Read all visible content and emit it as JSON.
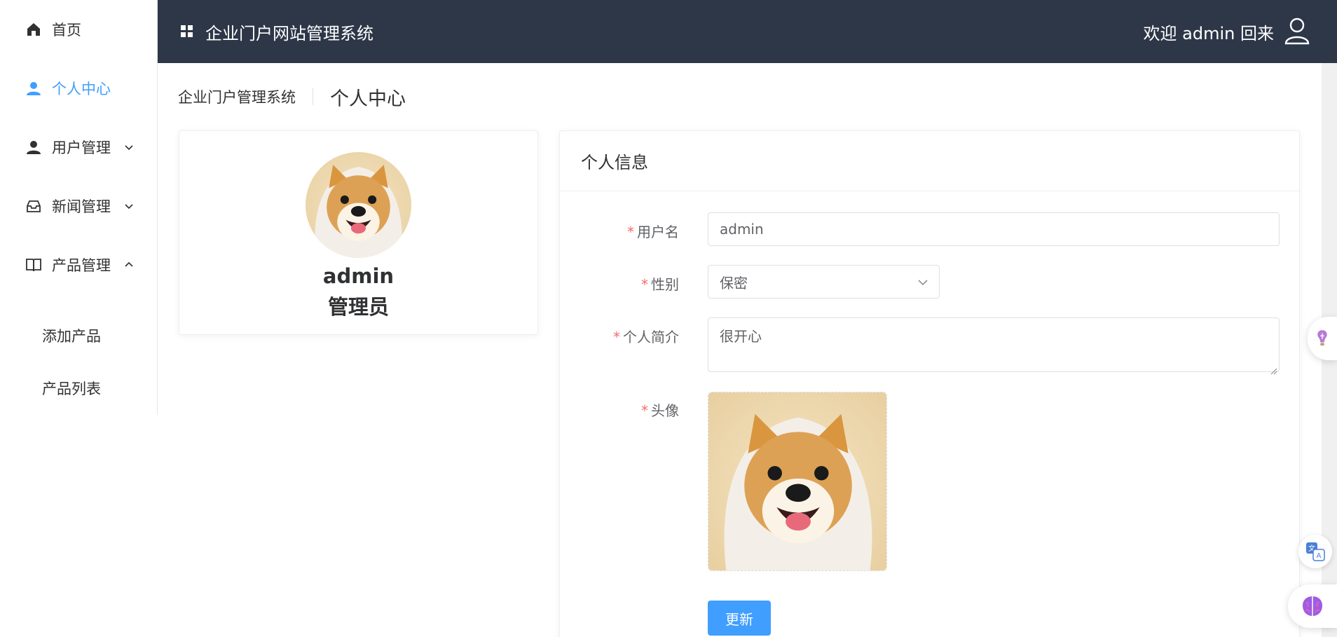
{
  "sidebar": {
    "items": [
      {
        "label": "首页",
        "icon": "home-icon"
      },
      {
        "label": "个人中心",
        "icon": "user-icon",
        "active": true
      },
      {
        "label": "用户管理",
        "icon": "user-icon",
        "expanded": false
      },
      {
        "label": "新闻管理",
        "icon": "inbox-icon",
        "expanded": false
      },
      {
        "label": "产品管理",
        "icon": "book-icon",
        "expanded": true
      }
    ],
    "subitems": [
      {
        "label": "添加产品"
      },
      {
        "label": "产品列表"
      }
    ],
    "active_color": "#409eff"
  },
  "header": {
    "title": "企业门户网站管理系统",
    "welcome": "欢迎 admin 回来",
    "background": "#2d3748"
  },
  "breadcrumb": {
    "root": "企业门户管理系统",
    "current": "个人中心"
  },
  "profile": {
    "name": "admin",
    "role": "管理员"
  },
  "info": {
    "title": "个人信息",
    "fields": {
      "username": {
        "label": "用户名",
        "value": "admin",
        "required": true
      },
      "gender": {
        "label": "性别",
        "value": "保密",
        "required": true
      },
      "bio": {
        "label": "个人简介",
        "value": "很开心",
        "required": true
      },
      "avatar": {
        "label": "头像",
        "required": true
      }
    },
    "submit_label": "更新",
    "accent": "#409eff"
  }
}
